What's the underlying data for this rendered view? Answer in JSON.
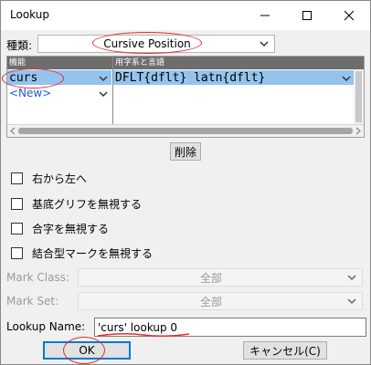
{
  "window": {
    "title": "Lookup"
  },
  "type_row": {
    "label": "種類:",
    "value": "Cursive Position"
  },
  "list": {
    "col_feature": "機能",
    "col_scripts": "用字系と言語",
    "rows": [
      {
        "feature": "curs",
        "scripts": "DFLT{dflt} latn{dflt}"
      },
      {
        "feature": "<New>"
      }
    ]
  },
  "delete_label": "削除",
  "checkboxes": [
    {
      "label": "右から左へ"
    },
    {
      "label": "基底グリフを無視する"
    },
    {
      "label": "合字を無視する"
    },
    {
      "label": "結合型マークを無視する"
    }
  ],
  "mark_class": {
    "label": "Mark Class:",
    "value": "全部"
  },
  "mark_set": {
    "label": "Mark Set:",
    "value": "全部"
  },
  "lookup_name": {
    "label": "Lookup Name:",
    "value": "'curs' lookup 0"
  },
  "buttons": {
    "ok": "OK",
    "cancel": "キャンセル(C)"
  },
  "colors": {
    "selection": "#94c4ee",
    "new_text": "#1f5bd6",
    "annotation": "#e03030"
  }
}
